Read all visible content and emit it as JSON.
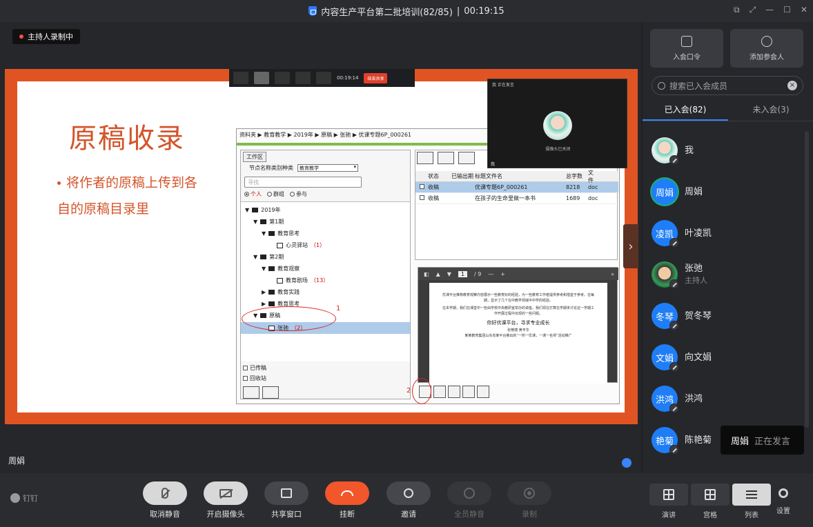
{
  "window": {
    "title": "内容生产平台第二批培训(82/85)",
    "timer": "00:19:15"
  },
  "stage": {
    "recording_badge": "主持人录制中",
    "speaker_name": "周娟"
  },
  "slide": {
    "title": "原稿收录",
    "bullet_line1": "将作者的原稿上传到各",
    "bullet_line2": "自的原稿目录里"
  },
  "mini_toolbar": {
    "time": "00:19:14",
    "end_label": "结束共享"
  },
  "software": {
    "breadcrumb": "资料夹  ▶  教育教学  ▶  2019年  ▶  原稿  ▶  张驰  ▶  优课专题6P_000261",
    "work_tab": "工作区",
    "node_type_label": "节点名称类别种类",
    "node_type_value": "教育教学",
    "search_placeholder": "寻找",
    "radio_personal": "个人",
    "radio_group": "群组",
    "radio_join": "参与",
    "tree": [
      {
        "label": "2019年",
        "level": 0,
        "kind": "root"
      },
      {
        "label": "第1期",
        "level": 1,
        "kind": "folder"
      },
      {
        "label": "教育思考",
        "level": 2,
        "kind": "folder"
      },
      {
        "label": "心灵驿站",
        "count": "（1）",
        "level": 3,
        "kind": "doc"
      },
      {
        "label": "第2期",
        "level": 1,
        "kind": "folder"
      },
      {
        "label": "教育观察",
        "level": 2,
        "kind": "folder"
      },
      {
        "label": "教育剧场",
        "count": "（13）",
        "level": 3,
        "kind": "doc"
      },
      {
        "label": "教育实践",
        "level": 2,
        "kind": "folder"
      },
      {
        "label": "教育思考",
        "level": 2,
        "kind": "folder"
      },
      {
        "label": "原稿",
        "level": 1,
        "kind": "folder"
      },
      {
        "label": "张驰",
        "count": "（2）",
        "level": 2,
        "kind": "doc"
      }
    ],
    "check_published": "已传稿",
    "check_recycle": "回收站",
    "table_headers": [
      "状态",
      "已输出期",
      "标题文件名",
      "总字数",
      "文件"
    ],
    "table_rows": [
      {
        "status": "收稿",
        "title": "优课专题6P_000261",
        "words": "8218",
        "file": "doc"
      },
      {
        "status": "收稿",
        "title": "在孩子的生命里做一本书",
        "words": "1689",
        "file": "doc"
      }
    ],
    "viewer_page": "1",
    "viewer_total": "/ 9",
    "viewer_text1": "优课平台推荐教育观察内容展示一些教育好的经验，为一些教育工作者提供参考和借鉴于参考。在每期，显示了几个在中教学领域中中学的经验。",
    "viewer_text2": "在本学期，我们在课堂中一些由学校中央教研室举办的讲座。我们现在打算在学期末讨论这一学期工作开展过程中出现的一些问题。",
    "viewer_title": "你好优课平台，寻求专业成长",
    "viewer_author": "张艳丽    黄丰华",
    "viewer_text3": "某某教育集团山东省某平台推出的“一所一优课，一课一名师”活动推广"
  },
  "annotations": {
    "one": "1",
    "two": "2"
  },
  "camera": {
    "header": "我  正在发言",
    "status": "摄像头已关闭",
    "name": "我"
  },
  "panel": {
    "join_code_label": "入会口令",
    "add_participant_label": "添加参会人",
    "search_placeholder": "搜索已入会成员",
    "tab_joined": "已入会(82)",
    "tab_not_joined": "未入会(3)",
    "members": [
      {
        "name": "我",
        "avatar": "",
        "photo": "me"
      },
      {
        "name": "周娟",
        "avatar": "周娟",
        "ring": true
      },
      {
        "name": "叶凌凯",
        "avatar": "凌凯"
      },
      {
        "name": "张弛",
        "role": "主持人",
        "avatar": "",
        "photo": "host"
      },
      {
        "name": "贺冬琴",
        "avatar": "冬琴"
      },
      {
        "name": "向文娟",
        "avatar": "文娟"
      },
      {
        "name": "洪鸿",
        "avatar": "洪鸿"
      },
      {
        "name": "陈艳菊",
        "avatar": "艳菊"
      }
    ],
    "speaking_name": "周娟",
    "speaking_status": "正在发言"
  },
  "toolbar": {
    "brand": "钉钉",
    "unmute": "取消静音",
    "camera": "开启摄像头",
    "share": "共享窗口",
    "hangup": "挂断",
    "invite": "邀请",
    "mute_all": "全员静音",
    "record": "录制",
    "view_speaker": "演讲",
    "view_grid": "宫格",
    "view_list": "列表",
    "settings": "设置"
  }
}
